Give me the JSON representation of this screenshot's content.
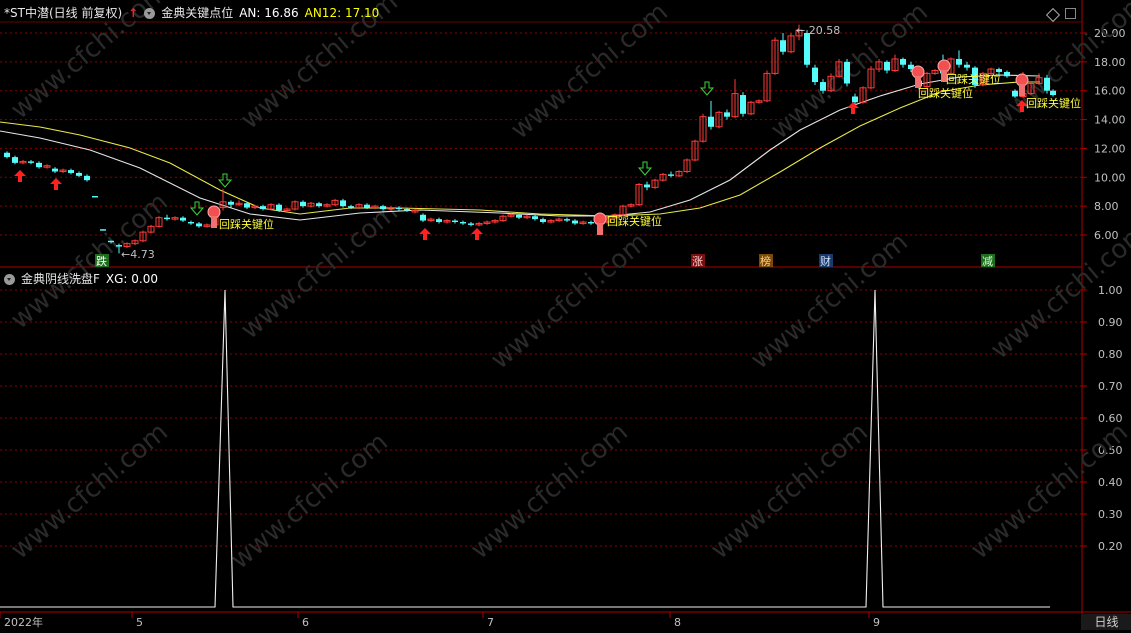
{
  "top_panel": {
    "stock_name": "*ST中潜(日线 前复权)",
    "indicator_name": "金典关键点位",
    "an_label": "AN: 16.86",
    "an12_label": "AN12: 17.10",
    "high_label": "20.58",
    "low_label": "4.73",
    "price_ticks": [
      "20.00",
      "18.00",
      "16.00",
      "14.00",
      "12.00",
      "10.00",
      "8.00",
      "6.00"
    ],
    "signal_label": "回踩关键位",
    "events": [
      "跌",
      "涨",
      "榜",
      "财",
      "减"
    ]
  },
  "bottom_panel": {
    "indicator_name": "金典阴线洗盘F",
    "xg_label": "XG: 0.00",
    "value_ticks": [
      "1.00",
      "0.90",
      "0.80",
      "0.70",
      "0.60",
      "0.50",
      "0.40",
      "0.30",
      "0.20"
    ]
  },
  "time_axis": {
    "labels": [
      "2022年",
      "5",
      "6",
      "7",
      "8",
      "9"
    ],
    "period_tab": "日线"
  },
  "watermark": "www.cfchi.com",
  "colors": {
    "grid": "#8b0000",
    "up": "#ff3b3b",
    "down": "#54fcfc",
    "ma_white": "#e6e6e6",
    "ma_yellow": "#e8e84a",
    "axis_text": "#c0c0c0"
  }
}
